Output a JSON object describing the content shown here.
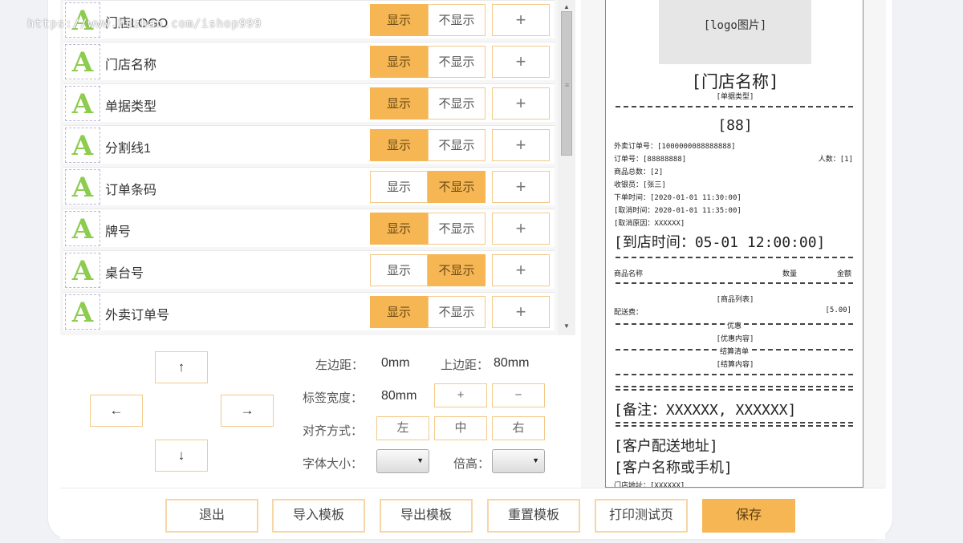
{
  "watermark": "https://www.huzhan.com/ishop999",
  "fields": [
    {
      "label": "门店LOGO",
      "show": "显示",
      "hide": "不显示",
      "selected": "show"
    },
    {
      "label": "门店名称",
      "show": "显示",
      "hide": "不显示",
      "selected": "show"
    },
    {
      "label": "单据类型",
      "show": "显示",
      "hide": "不显示",
      "selected": "show"
    },
    {
      "label": "分割线1",
      "show": "显示",
      "hide": "不显示",
      "selected": "show"
    },
    {
      "label": "订单条码",
      "show": "显示",
      "hide": "不显示",
      "selected": "hide"
    },
    {
      "label": "牌号",
      "show": "显示",
      "hide": "不显示",
      "selected": "show"
    },
    {
      "label": "桌台号",
      "show": "显示",
      "hide": "不显示",
      "selected": "hide"
    },
    {
      "label": "外卖订单号",
      "show": "显示",
      "hide": "不显示",
      "selected": "show"
    }
  ],
  "field_icon": "A",
  "add_symbol": "+",
  "scroll": {
    "up": "▲",
    "down": "▼",
    "grip": "≡"
  },
  "controls": {
    "arrows": {
      "up": "↑",
      "left": "←",
      "right": "→",
      "down": "↓"
    },
    "left_margin_label": "左边距：",
    "left_margin_value": "0mm",
    "top_margin_label": "上边距：",
    "top_margin_value": "80mm",
    "label_width_label": "标签宽度：",
    "label_width_value": "80mm",
    "plus": "+",
    "minus": "−",
    "align_label": "对齐方式：",
    "align_left": "左",
    "align_center": "中",
    "align_right": "右",
    "font_size_label": "字体大小：",
    "line_height_label": "倍高：",
    "caret": "▼"
  },
  "bottom_buttons": {
    "exit": "退出",
    "import": "导入模板",
    "export": "导出模板",
    "reset": "重置模板",
    "print_test": "打印测试页",
    "save": "保存"
  },
  "receipt": {
    "logo": "[logo图片]",
    "store_name": "[门店名称]",
    "doc_type": "[单据类型]",
    "number": "[88]",
    "takeout_no": "外卖订单号：[1000000088888888]",
    "order_no": "订单号：[88888888]",
    "people": "人数：[1]",
    "total_qty": "商品总数：[2]",
    "cashier": "收银员：[张三]",
    "order_time": "下单时间：[2020-01-01 11:30:00]",
    "cancel_time": "[取消时间：2020-01-01 11:35:00]",
    "cancel_reason": "[取消原因：XXXXXX]",
    "arrive_time": "[到店时间：05-01 12:00:00]",
    "col_name": "商品名称",
    "col_qty": "数量",
    "col_amount": "金额",
    "item_list": "[商品列表]",
    "delivery_fee_label": "配送费：",
    "delivery_fee_value": "[5.00]",
    "discount_title": "优惠",
    "discount_content": "[优惠内容]",
    "settle_title": "结算清单",
    "settle_content": "[结算内容]",
    "remark": "[备注：XXXXXX, XXXXXX]",
    "address": "[客户配送地址]",
    "customer": "[客户名称或手机]",
    "store_address": "门店地址：[XXXXXX]"
  }
}
